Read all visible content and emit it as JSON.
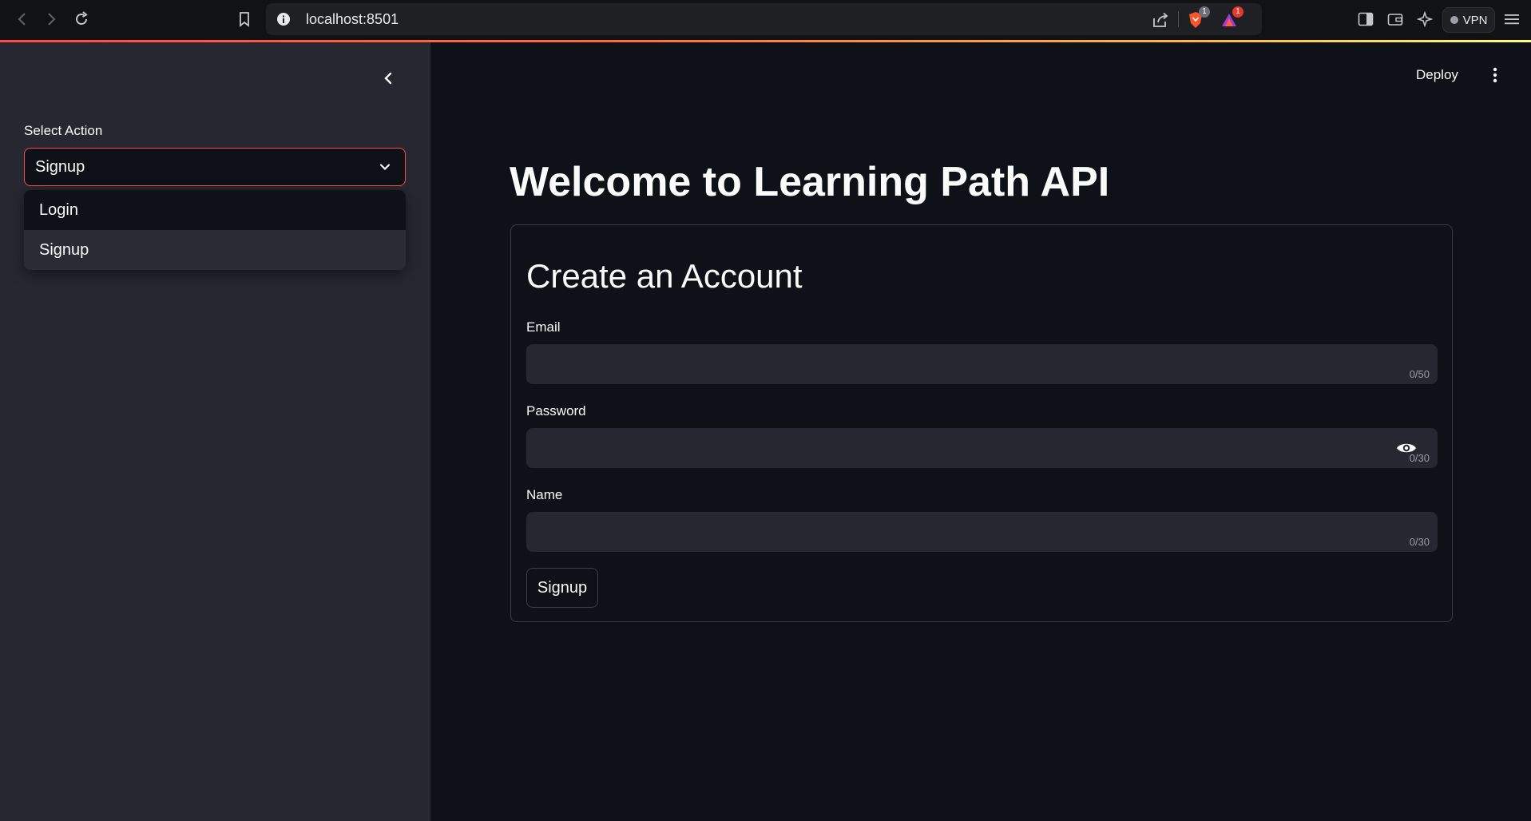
{
  "browser": {
    "url": "localhost:8501",
    "brave_badge": "1",
    "rewards_badge": "1",
    "vpn_label": "VPN"
  },
  "sidebar": {
    "select_label": "Select Action",
    "select_value": "Signup",
    "options": [
      "Login",
      "Signup"
    ],
    "highlighted_option": "Login"
  },
  "toolbar": {
    "deploy_label": "Deploy"
  },
  "main": {
    "title": "Welcome to Learning Path API",
    "form": {
      "title": "Create an Account",
      "email_label": "Email",
      "email_value": "",
      "email_counter": "0/50",
      "password_label": "Password",
      "password_value": "",
      "password_counter": "0/30",
      "name_label": "Name",
      "name_value": "",
      "name_counter": "0/30",
      "submit_label": "Signup"
    }
  },
  "colors": {
    "accent": "#ff4b4b",
    "background": "#0e1117",
    "sidebar": "#262730"
  }
}
